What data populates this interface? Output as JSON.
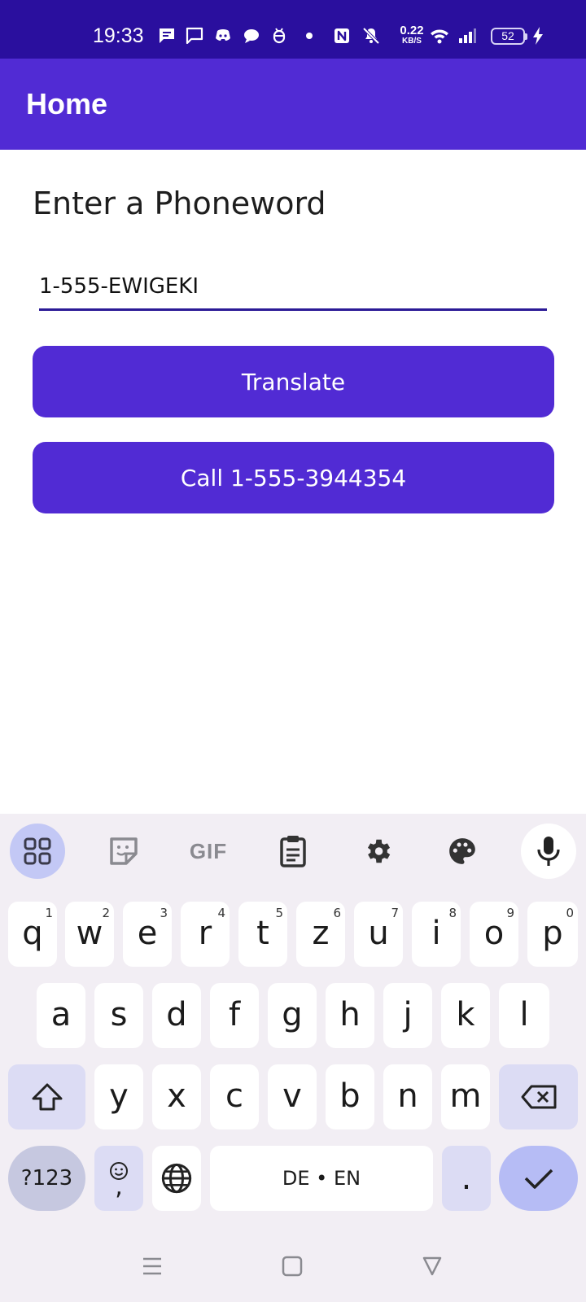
{
  "status_bar": {
    "time": "19:33",
    "net_speed_value": "0.22",
    "net_speed_unit": "KB/S",
    "battery_level": "52",
    "icons": [
      "message-icon",
      "chat-icon",
      "discord-icon",
      "chat-bubble-icon",
      "bug-icon",
      "dot-icon",
      "nfc-icon",
      "mute-icon",
      "wifi-icon",
      "signal-icon",
      "battery-icon",
      "charging-icon"
    ]
  },
  "app_bar": {
    "title": "Home"
  },
  "main": {
    "prompt": "Enter a Phoneword",
    "phoneword_input": {
      "value": "1-555-EWIGEKI"
    },
    "translate_button": "Translate",
    "call_button": "Call 1-555-3944354"
  },
  "keyboard": {
    "toolbar": [
      "apps-grid-icon",
      "sticker-icon",
      "gif-icon",
      "clipboard-icon",
      "settings-icon",
      "palette-icon",
      "microphone-icon"
    ],
    "gif_label": "GIF",
    "row1": [
      {
        "letter": "q",
        "hint": "1"
      },
      {
        "letter": "w",
        "hint": "2"
      },
      {
        "letter": "e",
        "hint": "3"
      },
      {
        "letter": "r",
        "hint": "4"
      },
      {
        "letter": "t",
        "hint": "5"
      },
      {
        "letter": "z",
        "hint": "6"
      },
      {
        "letter": "u",
        "hint": "7"
      },
      {
        "letter": "i",
        "hint": "8"
      },
      {
        "letter": "o",
        "hint": "9"
      },
      {
        "letter": "p",
        "hint": "0"
      }
    ],
    "row2": [
      "a",
      "s",
      "d",
      "f",
      "g",
      "h",
      "j",
      "k",
      "l"
    ],
    "row3": [
      "y",
      "x",
      "c",
      "v",
      "b",
      "n",
      "m"
    ],
    "symbols_key": "?123",
    "emoji_key_comma": ",",
    "space_key": "DE • EN",
    "period_key": ".",
    "colors": {
      "accent": "#512bd4",
      "status_bar": "#2a0f9e"
    }
  },
  "nav_bar": {
    "icons": [
      "menu-icon",
      "home-icon",
      "back-icon"
    ]
  }
}
